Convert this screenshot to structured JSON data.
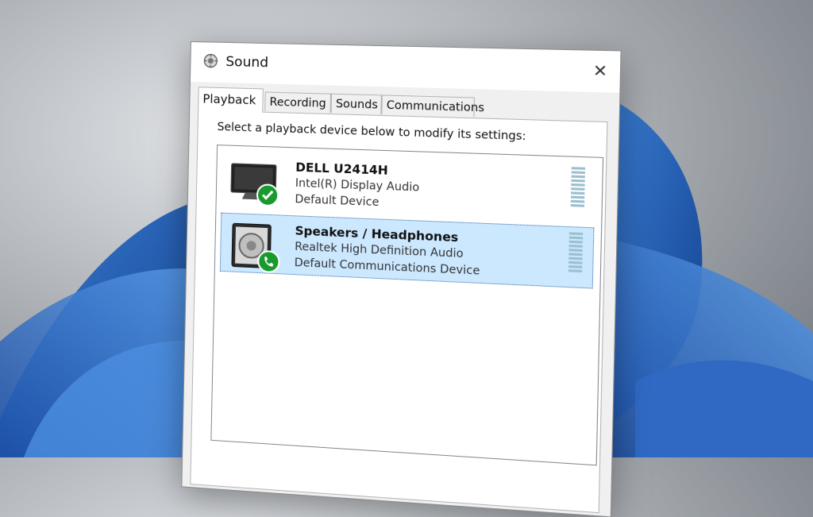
{
  "dialog": {
    "title": "Sound",
    "close_glyph": "✕",
    "icon": "speaker-settings-icon"
  },
  "tabs": [
    {
      "label": "Playback",
      "active": true
    },
    {
      "label": "Recording",
      "active": false
    },
    {
      "label": "Sounds",
      "active": false
    },
    {
      "label": "Communications",
      "active": false
    }
  ],
  "playback": {
    "instruction": "Select a playback device below to modify its settings:",
    "devices": [
      {
        "name": "DELL U2414H",
        "driver": "Intel(R) Display Audio",
        "status": "Default Device",
        "icon": "monitor-icon",
        "badge": "checkmark-badge-icon",
        "selected": false
      },
      {
        "name": "Speakers / Headphones",
        "driver": "Realtek High Definition Audio",
        "status": "Default Communications Device",
        "icon": "speaker-icon",
        "badge": "phone-badge-icon",
        "selected": true
      }
    ]
  },
  "colors": {
    "selection": "#cce8ff",
    "badge_green": "#1a9a2e",
    "meter": "#9cc0cf"
  }
}
